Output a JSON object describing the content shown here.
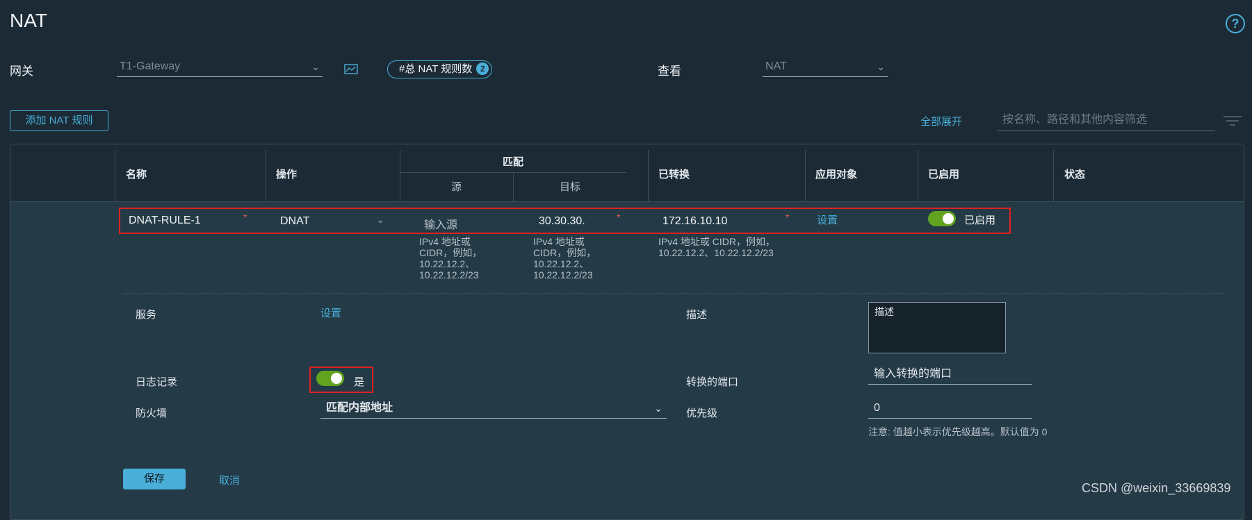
{
  "page": {
    "title": "NAT"
  },
  "toolbar": {
    "gateway_label": "网关",
    "gateway_value": "T1-Gateway",
    "rule_count_label": "#总 NAT 规则数",
    "rule_count": "2",
    "view_label": "查看",
    "view_value": "NAT"
  },
  "actions": {
    "add_rule": "添加 NAT 规则",
    "expand_all": "全部展开",
    "filter_placeholder": "按名称、路径和其他内容筛选"
  },
  "table": {
    "headers": {
      "name": "名称",
      "action": "操作",
      "match": "匹配",
      "match_source": "源",
      "match_target": "目标",
      "translated": "已转换",
      "applied_to": "应用对象",
      "enabled": "已启用",
      "status": "状态"
    },
    "row": {
      "name": "DNAT-RULE-1",
      "action": "DNAT",
      "source_placeholder": "输入源",
      "target": "30.30.30.",
      "translated": "172.16.10.10",
      "applied_to": "设置",
      "enabled_label": "已启用",
      "enabled": true,
      "required_mark": "*",
      "source_help": [
        "IPv4 地址或",
        "CIDR，例如，",
        "10.22.12.2、",
        "10.22.12.2/23"
      ],
      "target_help": [
        "IPv4 地址或",
        "CIDR，例如，",
        "10.22.12.2、",
        "10.22.12.2/23"
      ],
      "translated_help": [
        "IPv4 地址或 CIDR，例如，",
        "10.22.12.2、10.22.12.2/23"
      ]
    }
  },
  "form": {
    "service_label": "服务",
    "service_link": "设置",
    "description_label": "描述",
    "description_placeholder": "描述",
    "logging_label": "日志记录",
    "logging_value": "是",
    "logging_on": true,
    "translated_port_label": "转换的端口",
    "translated_port_placeholder": "输入转换的端口",
    "firewall_label": "防火墙",
    "firewall_value": "匹配内部地址",
    "priority_label": "优先级",
    "priority_value": "0",
    "priority_note": "注意: 值越小表示优先级越高。默认值为 0",
    "save": "保存",
    "cancel": "取消"
  },
  "watermark": "CSDN @weixin_33669839",
  "colors": {
    "accent": "#49afd9",
    "toggle_on": "#62a420",
    "highlight": "#e02020",
    "background": "#1b2a35"
  }
}
